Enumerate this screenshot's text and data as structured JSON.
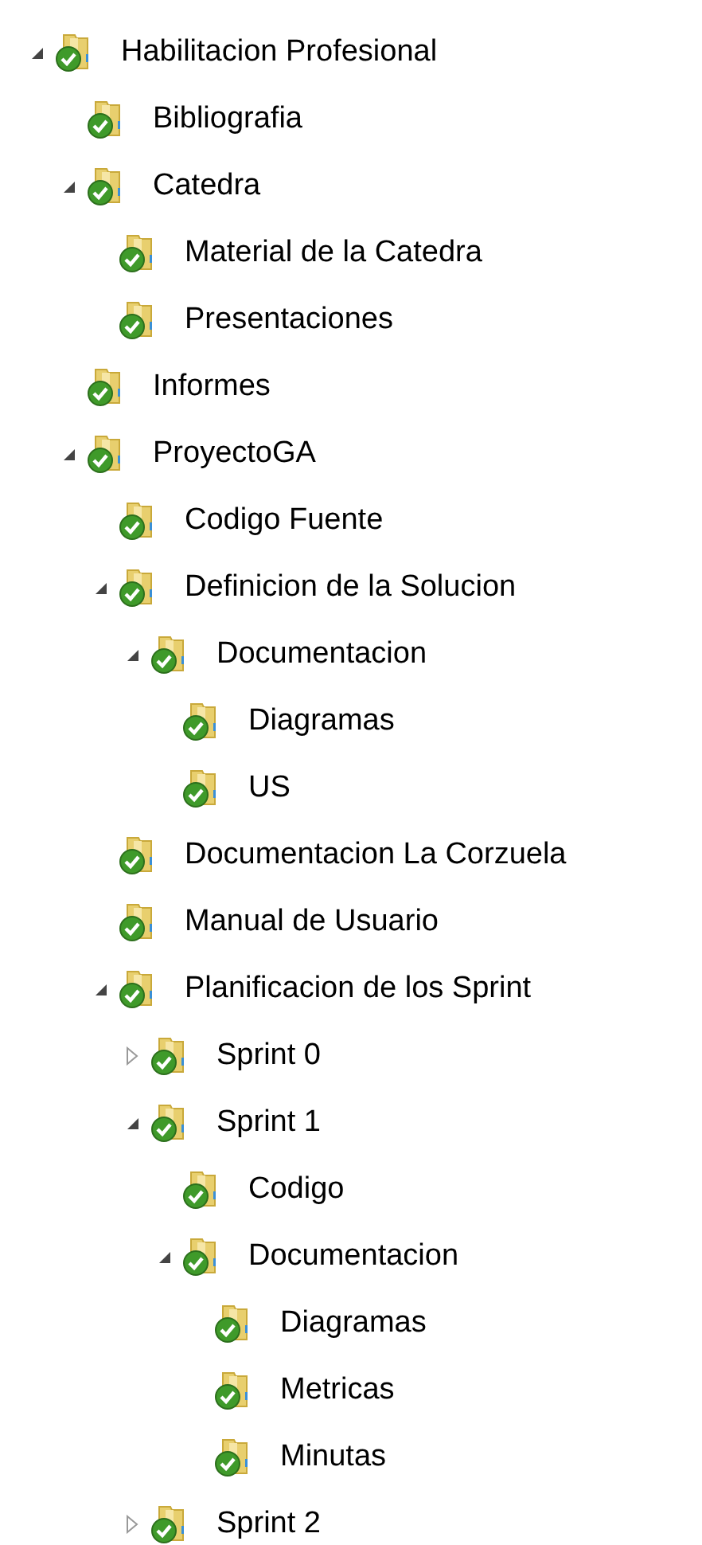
{
  "tree": [
    {
      "label": "Habilitacion Profesional",
      "expanded": true,
      "children": [
        {
          "label": "Bibliografia"
        },
        {
          "label": "Catedra",
          "expanded": true,
          "children": [
            {
              "label": "Material de la Catedra"
            },
            {
              "label": "Presentaciones"
            }
          ]
        },
        {
          "label": "Informes"
        },
        {
          "label": "ProyectoGA",
          "expanded": true,
          "children": [
            {
              "label": "Codigo Fuente"
            },
            {
              "label": "Definicion de la Solucion",
              "expanded": true,
              "children": [
                {
                  "label": "Documentacion",
                  "expanded": true,
                  "children": [
                    {
                      "label": "Diagramas"
                    },
                    {
                      "label": "US"
                    }
                  ]
                }
              ]
            },
            {
              "label": "Documentacion La Corzuela"
            },
            {
              "label": "Manual de Usuario"
            },
            {
              "label": "Planificacion de los Sprint",
              "expanded": true,
              "children": [
                {
                  "label": "Sprint 0",
                  "expanded": false
                },
                {
                  "label": "Sprint 1",
                  "expanded": true,
                  "children": [
                    {
                      "label": "Codigo"
                    },
                    {
                      "label": "Documentacion",
                      "expanded": true,
                      "children": [
                        {
                          "label": "Diagramas"
                        },
                        {
                          "label": "Metricas"
                        },
                        {
                          "label": "Minutas"
                        }
                      ]
                    }
                  ]
                },
                {
                  "label": "Sprint 2",
                  "expanded": false
                }
              ]
            }
          ]
        }
      ]
    }
  ]
}
